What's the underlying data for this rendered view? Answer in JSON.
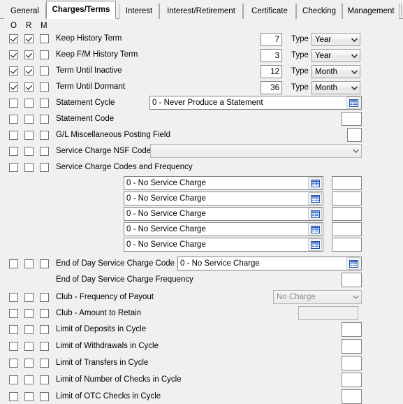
{
  "tabs": [
    {
      "label": "General",
      "active": false
    },
    {
      "label": "Charges/Terms",
      "active": true
    },
    {
      "label": "Interest",
      "active": false
    },
    {
      "label": "Interest/Retirement",
      "active": false
    },
    {
      "label": "Certificate",
      "active": false
    },
    {
      "label": "Checking",
      "active": false
    },
    {
      "label": "Management",
      "active": false
    }
  ],
  "column_headers": {
    "o": "O",
    "r": "R",
    "m": "M"
  },
  "type_label": "Type",
  "term_rows": [
    {
      "label": "Keep History Term",
      "o": true,
      "r": true,
      "m": false,
      "value": "7",
      "type": "Year"
    },
    {
      "label": "Keep F/M History Term",
      "o": true,
      "r": true,
      "m": false,
      "value": "3",
      "type": "Year"
    },
    {
      "label": "Term Until Inactive",
      "o": true,
      "r": true,
      "m": false,
      "value": "12",
      "type": "Month"
    },
    {
      "label": "Term Until Dormant",
      "o": true,
      "r": true,
      "m": false,
      "value": "36",
      "type": "Month"
    }
  ],
  "statement_cycle": {
    "label": "Statement Cycle",
    "value": "0 - Never Produce a Statement",
    "o": false,
    "r": false,
    "m": false
  },
  "statement_code": {
    "label": "Statement Code",
    "value": "",
    "o": false,
    "r": false,
    "m": false
  },
  "gl_misc_posting": {
    "label": "G/L Miscellaneous Posting Field",
    "value": "",
    "o": false,
    "r": false,
    "m": false
  },
  "service_charge_nsf": {
    "label": "Service Charge NSF Code",
    "value": "",
    "o": false,
    "r": false,
    "m": false,
    "disabled": true
  },
  "service_charge_group": {
    "label": "Service Charge Codes and Frequency",
    "o": false,
    "r": false,
    "m": false,
    "rows": [
      {
        "code": "0 - No Service Charge",
        "frequency": ""
      },
      {
        "code": "0 - No Service Charge",
        "frequency": ""
      },
      {
        "code": "0 - No Service Charge",
        "frequency": ""
      },
      {
        "code": "0 - No Service Charge",
        "frequency": ""
      },
      {
        "code": "0 - No Service Charge",
        "frequency": ""
      }
    ]
  },
  "eod_code": {
    "label": "End of Day Service Charge Code",
    "value": "0 - No Service Charge",
    "o": false,
    "r": false,
    "m": false
  },
  "eod_frequency": {
    "label": "End of Day Service Charge Frequency",
    "value": ""
  },
  "club_payout": {
    "label": "Club - Frequency of Payout",
    "value": "No Charge",
    "o": false,
    "r": false,
    "m": false,
    "disabled": true
  },
  "club_retain": {
    "label": "Club - Amount to Retain",
    "value": "",
    "o": false,
    "r": false,
    "m": false,
    "disabled": true
  },
  "limit_rows": [
    {
      "label": "Limit of Deposits in Cycle",
      "value": "",
      "o": false,
      "r": false,
      "m": false
    },
    {
      "label": "Limit of Withdrawals in Cycle",
      "value": "",
      "o": false,
      "r": false,
      "m": false
    },
    {
      "label": "Limit of Transfers in Cycle",
      "value": "",
      "o": false,
      "r": false,
      "m": false
    },
    {
      "label": "Limit of Number of Checks in Cycle",
      "value": "",
      "o": false,
      "r": false,
      "m": false
    },
    {
      "label": "Limit of OTC Checks in Cycle",
      "value": "",
      "o": false,
      "r": false,
      "m": false
    }
  ],
  "icons": {
    "lookup": "list-lookup-icon",
    "dropdown": "chevron-down-icon"
  },
  "colors": {
    "background": "#f0f0f0",
    "field_border": "#848484",
    "lookup_icon": "#1a4fb4",
    "active_tab": "#ffffff"
  }
}
